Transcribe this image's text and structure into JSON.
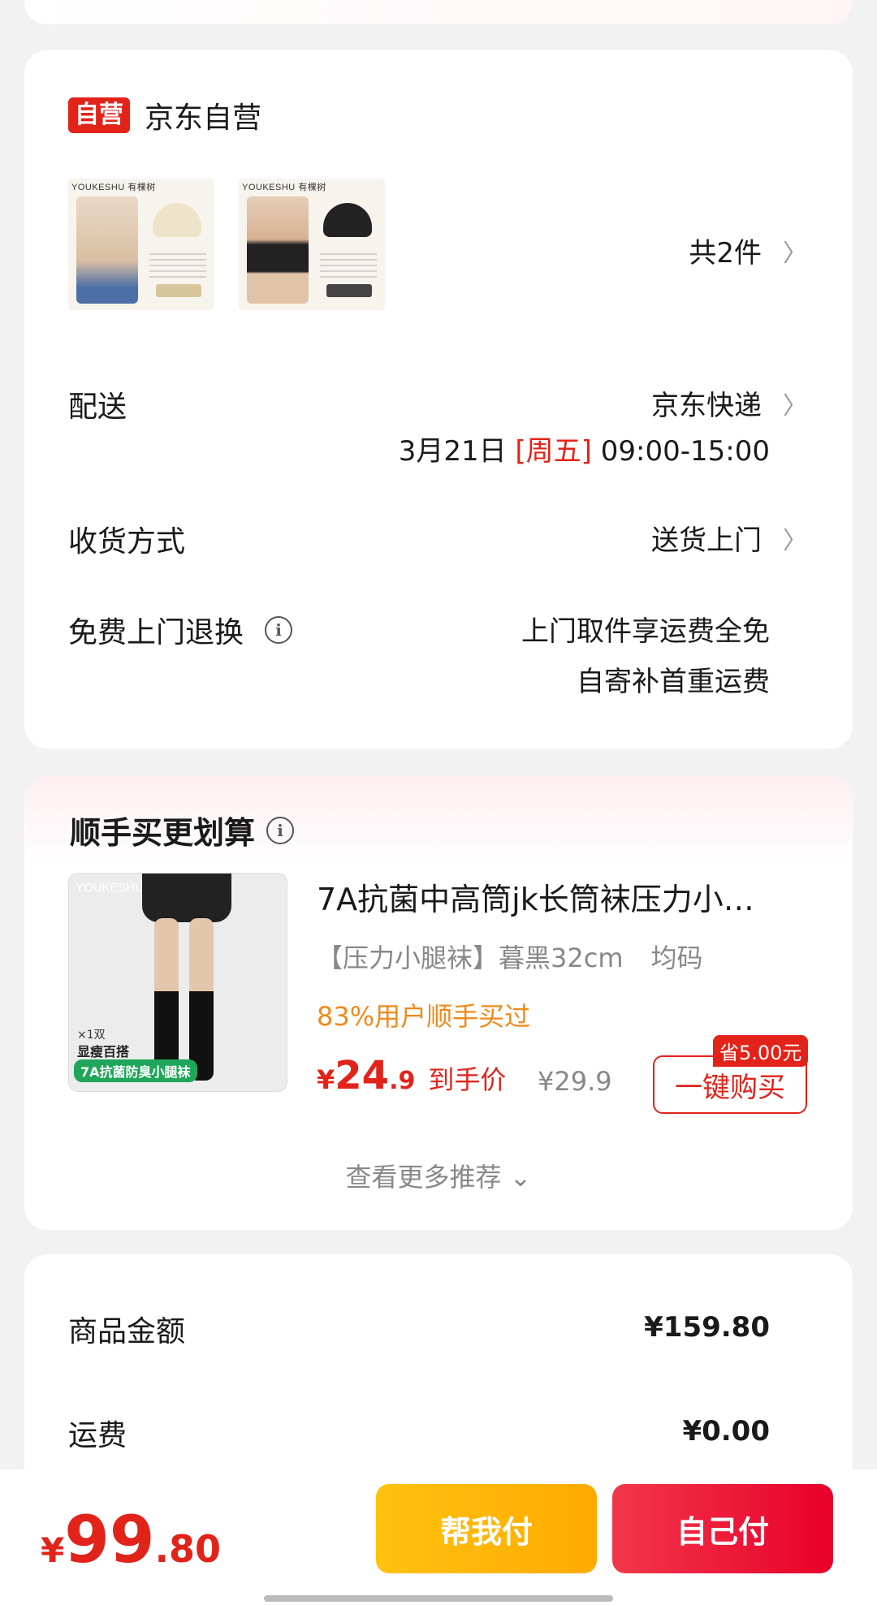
{
  "shop": {
    "tag": "自营",
    "name": "京东自营"
  },
  "items": {
    "thumbs": [
      {
        "brand": "YOUKESHU 有棵树",
        "accent": "#efe3c9",
        "pill": "#d7c59c"
      },
      {
        "brand": "YOUKESHU 有棵树",
        "accent": "#222222",
        "pill": "#444444"
      }
    ],
    "count": "共2件"
  },
  "delivery": {
    "label": "配送",
    "carrier": "京东快递",
    "date": "3月21日",
    "weekday": "[周五]",
    "time": "09:00-15:00"
  },
  "receive": {
    "label": "收货方式",
    "value": "送货上门"
  },
  "returns": {
    "label": "免费上门退换",
    "line1": "上门取件享运费全免",
    "line2": "自寄补首重运费"
  },
  "recommend": {
    "title": "顺手买更划算",
    "image": {
      "brand": "YOUKESHU 有棵树",
      "note1": "×1双",
      "note2": "显瘦百搭",
      "badge": "7A抗菌防臭小腿袜"
    },
    "name": "7A抗菌中高筒jk长筒袜压力小…",
    "spec": "【压力小腿袜】暮黑32cm",
    "size": "均码",
    "percent": "83%用户顺手买过",
    "price_symbol": "¥",
    "price_int": "24",
    "price_dec": ".9",
    "price_label": "到手价",
    "original": "¥29.9",
    "save": "省5.00元",
    "buy": "一键购买",
    "more": "查看更多推荐 ⌄"
  },
  "summary": {
    "goods_label": "商品金额",
    "goods_value": "¥159.80",
    "shipping_label": "运费",
    "shipping_value": "¥0.00"
  },
  "bottom": {
    "symbol": "¥",
    "int": "99",
    "dec": ".80",
    "help": "帮我付",
    "self": "自己付"
  },
  "colors": {
    "accent": "#e2231a",
    "help_btn": "#ffb400",
    "self_btn": "#ee1133",
    "percent": "#f08a1a"
  }
}
